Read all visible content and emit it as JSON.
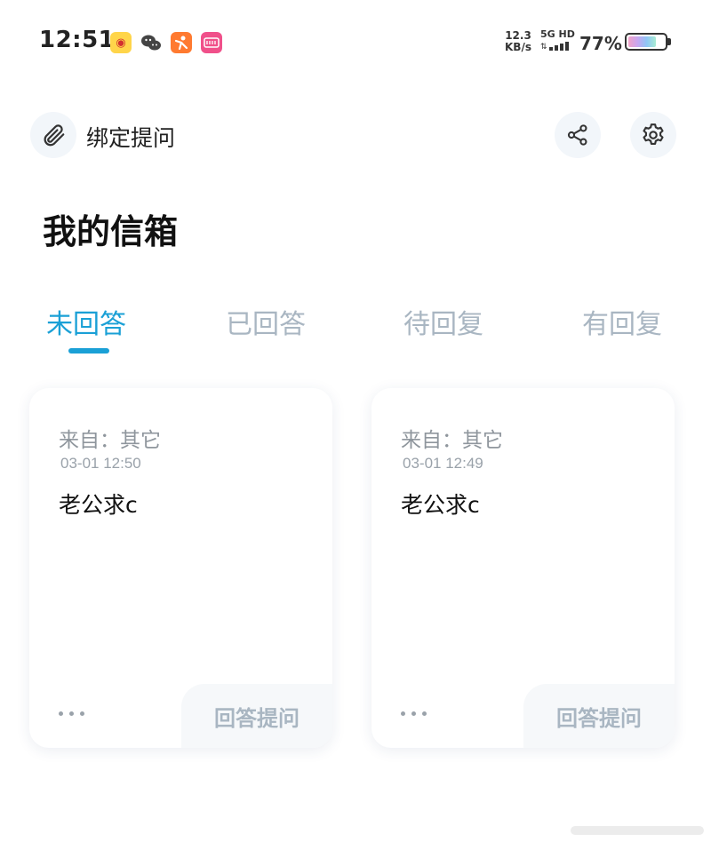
{
  "status_bar": {
    "time": "12:51",
    "net_speed_value": "12.3",
    "net_speed_unit": "KB/s",
    "network": "5G HD",
    "battery": "77%",
    "app_icons": [
      "weibo-icon",
      "wechat-icon",
      "orange-app-icon",
      "pink-app-icon"
    ]
  },
  "header": {
    "bind_label": "绑定提问",
    "share_icon": "share-icon",
    "settings_icon": "gear-icon",
    "clip_icon": "paperclip-icon"
  },
  "page_title": "我的信箱",
  "tabs": [
    {
      "label": "未回答",
      "active": true
    },
    {
      "label": "已回答",
      "active": false
    },
    {
      "label": "待回复",
      "active": false
    },
    {
      "label": "有回复",
      "active": false
    }
  ],
  "cards": [
    {
      "from": "来自：其它",
      "time": "03-01 12:50",
      "message": "老公求c",
      "answer_label": "回答提问"
    },
    {
      "from": "来自：其它",
      "time": "03-01 12:49",
      "message": "老公求c",
      "answer_label": "回答提问"
    }
  ],
  "colors": {
    "accent": "#1aa0d6",
    "inactive_tab": "#a9b6c2",
    "icon_bg": "#f2f6fa"
  }
}
